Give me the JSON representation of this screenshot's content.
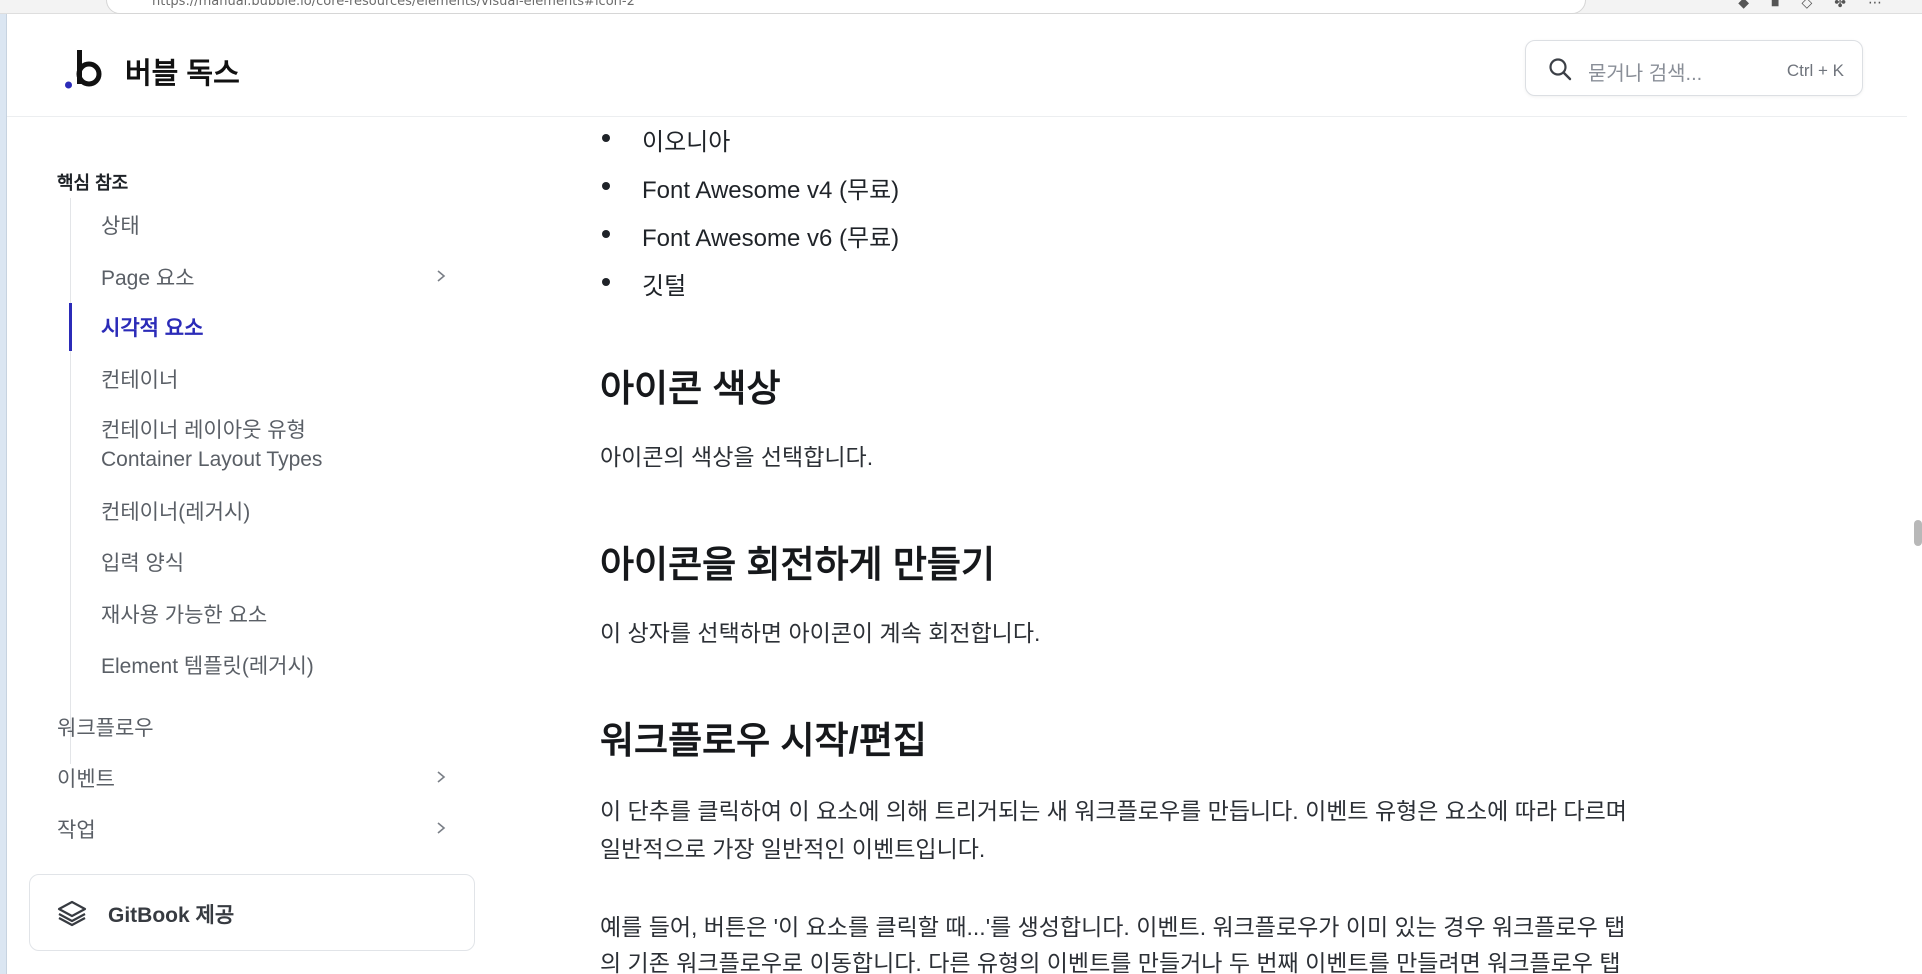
{
  "browser": {
    "url": "https://manual.bubble.io/core-resources/elements/visual-elements#icon-2"
  },
  "header": {
    "site_title": "버블 독스",
    "search_placeholder": "묻거나 검색...",
    "search_shortcut": "Ctrl + K"
  },
  "sidebar": {
    "section_title": "핵심 참조",
    "items": [
      {
        "label": "상태"
      },
      {
        "label": "Page 요소"
      },
      {
        "label": "시각적 요소"
      },
      {
        "label": "컨테이너"
      },
      {
        "label": "컨테이너 레이아웃 유형",
        "sub": "Container Layout Types"
      },
      {
        "label": "컨테이너(레거시)"
      },
      {
        "label": "입력 양식"
      },
      {
        "label": "재사용 가능한 요소"
      },
      {
        "label": "Element 템플릿(레거시)"
      }
    ],
    "top_items": [
      {
        "label": "워크플로우"
      },
      {
        "label": "이벤트"
      },
      {
        "label": "작업"
      }
    ],
    "gitbook_label": "GitBook 제공"
  },
  "main": {
    "bullets": [
      "이오니아",
      "Font Awesome v4 (무료)",
      "Font Awesome v6 (무료)",
      "깃털"
    ],
    "sections": [
      {
        "heading": "아이콘 색상",
        "paragraphs": [
          "아이콘의 색상을 선택합니다."
        ]
      },
      {
        "heading": "아이콘을 회전하게 만들기",
        "paragraphs": [
          "이 상자를 선택하면 아이콘이 계속 회전합니다."
        ]
      },
      {
        "heading": "워크플로우 시작/편집",
        "paragraphs": [
          "이 단추를 클릭하여 이 요소에 의해 트리거되는 새 워크플로우를 만듭니다. 이벤트 유형은 요소에 따라 다르며",
          "일반적으로 가장 일반적인 이벤트입니다.",
          "예를 들어, 버튼은 '이 요소를 클릭할 때...'를 생성합니다. 이벤트. 워크플로우가 이미 있는 경우 워크플로우 탭",
          "의 기존 워크플로우로 이동합니다. 다른 유형의 이벤트를 만들거나 두 번째 이벤트를 만들려면 워크플로우 탭"
        ]
      }
    ]
  },
  "colors": {
    "accent": "#2b2bb8",
    "text": "#1f2328",
    "muted": "#5a5f66"
  }
}
